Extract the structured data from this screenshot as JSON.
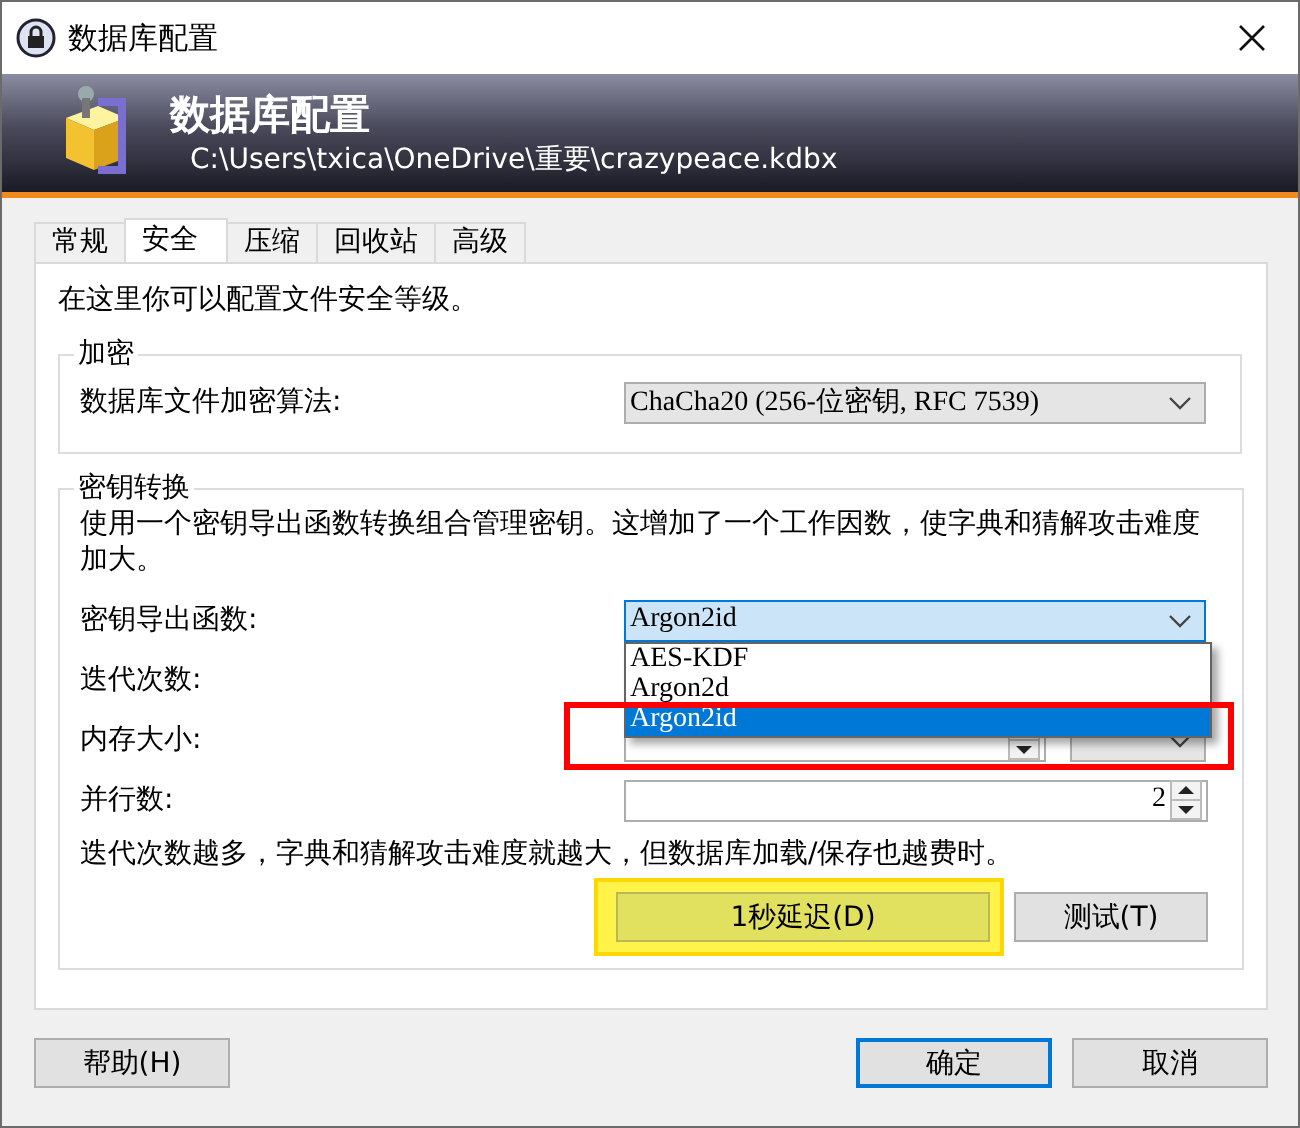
{
  "window": {
    "title": "数据库配置"
  },
  "header": {
    "title": "数据库配置",
    "path": "C:\\Users\\txica\\OneDrive\\重要\\crazypeace.kdbx"
  },
  "tabs": [
    {
      "label": "常规",
      "selected": false
    },
    {
      "label": "安全",
      "selected": true
    },
    {
      "label": "压缩",
      "selected": false
    },
    {
      "label": "回收站",
      "selected": false
    },
    {
      "label": "高级",
      "selected": false
    }
  ],
  "intro": "在这里你可以配置文件安全等级。",
  "encryption": {
    "legend": "加密",
    "label": "数据库文件加密算法:",
    "value": "ChaCha20 (256-位密钥, RFC 7539)"
  },
  "key_transformation": {
    "legend": "密钥转换",
    "description": "使用一个密钥导出函数转换组合管理密钥。这增加了一个工作因数，使字典和猜解攻击难度加大。",
    "kdf": {
      "label": "密钥导出函数:",
      "value": "Argon2id",
      "expanded": true,
      "options": [
        {
          "label": "AES-KDF",
          "selected": false
        },
        {
          "label": "Argon2d",
          "selected": false
        },
        {
          "label": "Argon2id",
          "selected": true
        }
      ]
    },
    "iterations": {
      "label": "迭代次数:"
    },
    "memory": {
      "label": "内存大小:"
    },
    "parallelism": {
      "label": "并行数:",
      "value": "2"
    },
    "note": "迭代次数越多，字典和猜解攻击难度就越大，但数据库加载/保存也越费时。",
    "buttons": [
      {
        "label": "1秒延迟(D)",
        "highlighted": true
      },
      {
        "label": "测试(T)",
        "highlighted": false
      }
    ]
  },
  "buttons": [
    {
      "label": "帮助(H)",
      "default": false
    },
    {
      "label": "确定",
      "default": true
    },
    {
      "label": "取消",
      "default": false
    }
  ],
  "annotations": [
    {
      "kind": "frame"
    }
  ]
}
